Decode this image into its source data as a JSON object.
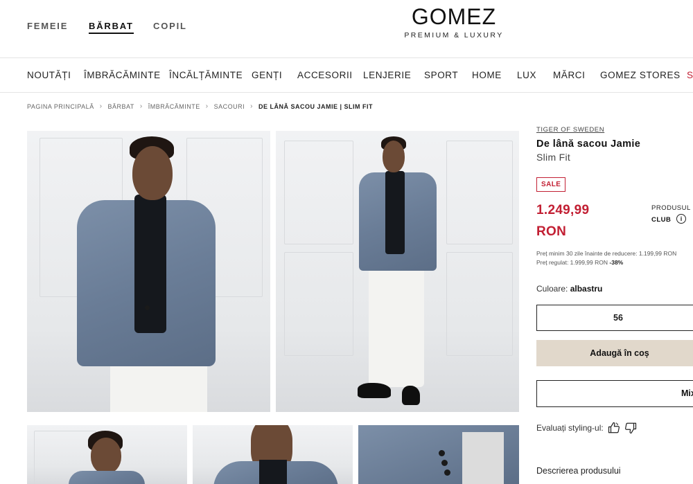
{
  "header": {
    "gender_tabs": [
      "FEMEIE",
      "BĂRBAT",
      "COPIL"
    ],
    "active_gender": "BĂRBAT",
    "logo": "GOMEZ",
    "tagline": "PREMIUM & LUXURY"
  },
  "nav": {
    "items": [
      "NOUTĂȚI",
      "ÎMBRĂCĂMINTE",
      "ÎNCĂLȚĂMINTE",
      "GENȚI",
      "ACCESORII",
      "LENJERIE",
      "SPORT",
      "HOME",
      "LUX",
      "MĂRCI",
      "GOMEZ STORES",
      "S"
    ]
  },
  "breadcrumb": [
    "PAGINA PRINCIPALĂ",
    "BĂRBAT",
    "ÎMBRĂCĂMINTE",
    "SACOURI",
    "DE LÂNĂ SACOU JAMIE | SLIM FIT"
  ],
  "product": {
    "brand": "TIGER OF SWEDEN",
    "title": "De lână sacou Jamie",
    "subtitle": "Slim Fit",
    "badge": "SALE",
    "price_amount": "1.249,99",
    "price_currency": "RON",
    "club_label": "PRODUSUL N",
    "club_tag": "CLUB",
    "info_icon": "i",
    "min_price_note": "Preț minim 30 zile înainte de reducere: 1.199,99 RON",
    "regular_price_note": "Preț regulat: 1.999,99 RON",
    "discount": "-38%",
    "color_label": "Culoare:",
    "color_value": "albastru",
    "size": "56",
    "add_to_cart": "Adaugă în coș",
    "mix_button": "Mix",
    "styling_label": "Evaluați styling-ul:",
    "description_title": "Descrierea produsului"
  },
  "colors": {
    "accent_red": "#c21f33",
    "cart_button_bg": "#e1d8cb",
    "jacket_blue": "#6a7d97"
  },
  "icons": {
    "breadcrumb_separator": "›",
    "thumbs_up": "thumbs-up-icon",
    "thumbs_down": "thumbs-down-icon"
  }
}
